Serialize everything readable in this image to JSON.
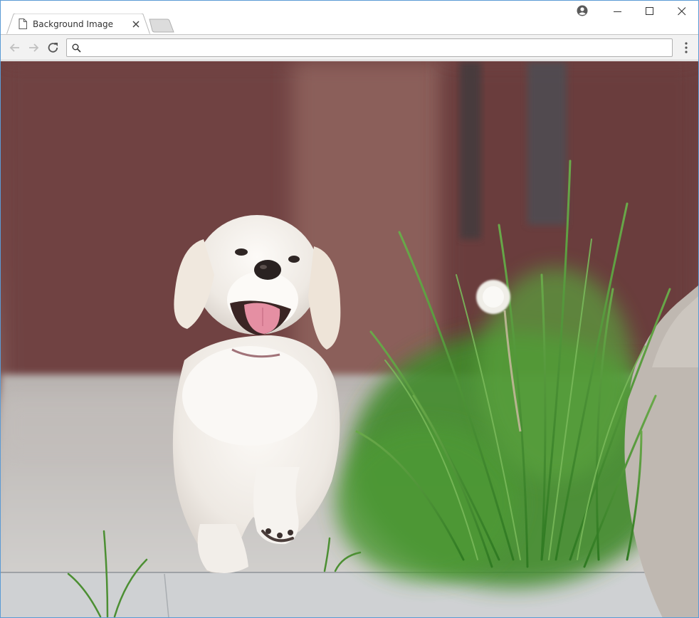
{
  "window": {
    "tab_title": "Background Image",
    "address_value": "",
    "address_placeholder": ""
  },
  "colors": {
    "window_border": "#5b9bd5",
    "toolbar_bg": "#f2f2f2",
    "tab_bg": "#ffffff",
    "icon_gray": "#5a5a5a",
    "icon_disabled": "#c0c0c0"
  },
  "icons": {
    "tab": "document-icon",
    "close": "close-icon",
    "profile": "profile-icon",
    "back": "arrow-left-icon",
    "forward": "arrow-right-icon",
    "reload": "reload-icon",
    "search": "search-icon",
    "menu": "kebab-menu-icon"
  }
}
